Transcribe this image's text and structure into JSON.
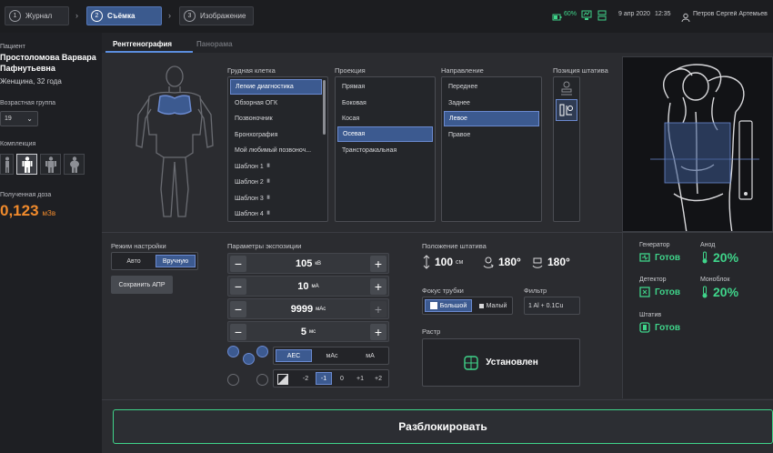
{
  "topbar": {
    "steps": [
      {
        "num": "1",
        "label": "Журнал"
      },
      {
        "num": "2",
        "label": "Съёмка"
      },
      {
        "num": "3",
        "label": "Изображение"
      }
    ],
    "battery": "60%",
    "date": "9 апр 2020",
    "time": "12:35",
    "user": "Петров Сергей Артемьев",
    "accent": "#3b5a8e"
  },
  "patient": {
    "label": "Пациент",
    "name_line1": "Простоломова Варвара",
    "name_line2": "Пафнутьевна",
    "info": "Женщина, 32 года",
    "age_group_label": "Возрастная группа",
    "age_group_value": "19",
    "build_label": "Комплекция",
    "dose_label": "Полученная доза",
    "dose_value": "0,123",
    "dose_unit": "мЗв",
    "dose_color": "#f08a2c"
  },
  "tabs": [
    "Рентгенография",
    "Панорама"
  ],
  "lists": {
    "region": {
      "header": "Грудная клетка",
      "items": [
        "Легкие диагностика",
        "Обзорная ОГК",
        "Позвоночник",
        "Бронхография",
        "Мой любимый позвоноч...",
        "Шаблон 1",
        "Шаблон 2",
        "Шаблон 3",
        "Шаблон 4"
      ]
    },
    "projection": {
      "header": "Проекция",
      "items": [
        "Прямая",
        "Боковая",
        "Косая",
        "Осевая",
        "Трансторакальная"
      ]
    },
    "direction": {
      "header": "Направление",
      "items": [
        "Переднее",
        "Заднее",
        "Левое",
        "Правое"
      ]
    },
    "stand_position": {
      "header": "Позиция штатива"
    }
  },
  "mode": {
    "label": "Режим настройки",
    "auto": "Авто",
    "manual": "Вручную",
    "save": "Сохранить АПР"
  },
  "exposure": {
    "label": "Параметры экспозиции",
    "rows": [
      {
        "value": "105",
        "unit": "кВ"
      },
      {
        "value": "10",
        "unit": "мА"
      },
      {
        "value": "9999",
        "unit": "мАс"
      },
      {
        "value": "5",
        "unit": "мс"
      }
    ],
    "aec_modes": [
      "AEC",
      "мАс",
      "мА"
    ],
    "density": [
      "-2",
      "-1",
      "0",
      "+1",
      "+2"
    ]
  },
  "stand": {
    "label": "Положение штатива",
    "height": "100",
    "height_unit": "см",
    "angle1": "180°",
    "angle2": "180°",
    "focus_label": "Фокус трубки",
    "focus_large": "Большой",
    "focus_small": "Малый",
    "filter_label": "Фильтр",
    "filter_value": "1 Al + 0.1Cu",
    "grid_label": "Растр",
    "grid_status": "Установлен"
  },
  "status": {
    "generator_label": "Генератор",
    "generator_value": "Готов",
    "anode_label": "Анод",
    "anode_value": "20%",
    "detector_label": "Детектор",
    "detector_value": "Готов",
    "monoblock_label": "Моноблок",
    "monoblock_value": "20%",
    "stand_label": "Штатив",
    "stand_value": "Готов",
    "ok_color": "#3fd48a"
  },
  "unlock": "Разблокировать"
}
